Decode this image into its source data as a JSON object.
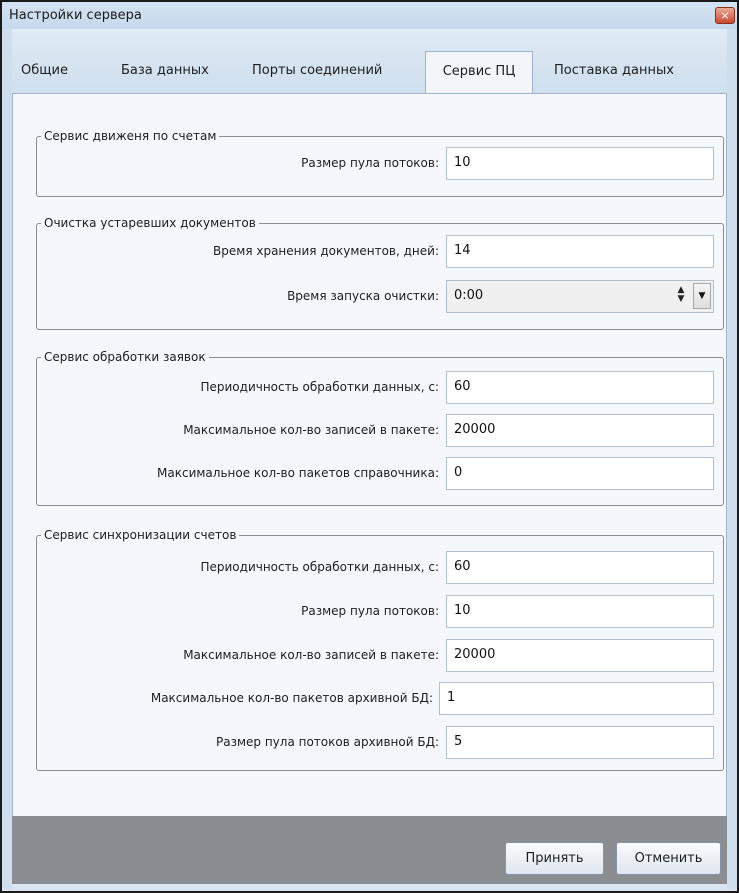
{
  "window": {
    "title": "Настройки сервера",
    "close_symbol": "×"
  },
  "tabs": [
    {
      "label": "Общие"
    },
    {
      "label": "База данных"
    },
    {
      "label": "Порты соединений"
    },
    {
      "label": "Сервис ПЦ",
      "active": true
    },
    {
      "label": "Поставка данных"
    }
  ],
  "groups": {
    "accounts_movement": {
      "title": "Сервис движеня по счетам",
      "pool_size_label": "Размер пула потоков:",
      "pool_size_value": "10"
    },
    "cleanup": {
      "title": "Очистка устаревших документов",
      "retention_label": "Время хранения документов, дней:",
      "retention_value": "14",
      "start_time_label": "Время запуска очистки:",
      "start_time_value": "0:00"
    },
    "requests": {
      "title": "Сервис обработки заявок",
      "period_label": "Периодичность обработки данных, с:",
      "period_value": "60",
      "max_records_label": "Максимальное кол-во записей в пакете:",
      "max_records_value": "20000",
      "max_packets_label": "Максимальное кол-во пакетов справочника:",
      "max_packets_value": "0"
    },
    "sync": {
      "title": "Сервис синхронизации счетов",
      "period_label": "Периодичность обработки данных, с:",
      "period_value": "60",
      "pool_size_label": "Размер пула потоков:",
      "pool_size_value": "10",
      "max_records_label": "Максимальное кол-во записей в пакете:",
      "max_records_value": "20000",
      "max_archive_packets_label": "Максимальное кол-во пакетов архивной БД:",
      "max_archive_packets_value": "1",
      "archive_pool_label": "Размер пула потоков архивной БД:",
      "archive_pool_value": "5"
    }
  },
  "buttons": {
    "apply": "Принять",
    "cancel": "Отменить"
  }
}
